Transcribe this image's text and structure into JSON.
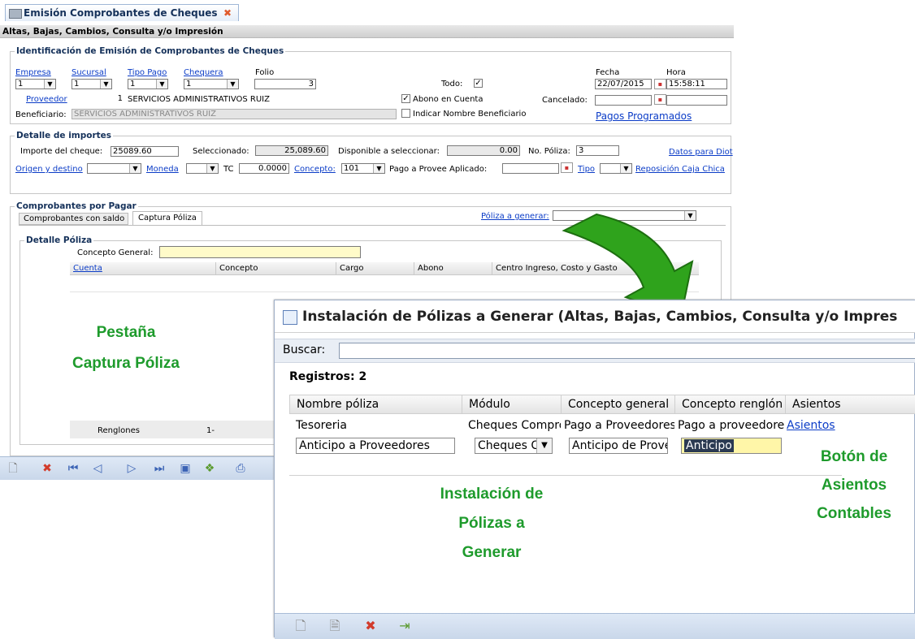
{
  "main": {
    "tab_title": "Emisión Comprobantes de Cheques",
    "subtitle": "Altas, Bajas, Cambios, Consulta y/o Impresión",
    "ident": {
      "legend": "Identificación de Emisión de Comprobantes de Cheques",
      "empresa_label": "Empresa",
      "empresa_value": "1",
      "sucursal_label": "Sucursal",
      "sucursal_value": "1",
      "tipo_pago_label": "Tipo Pago",
      "tipo_pago_value": "1",
      "chequera_label": "Chequera",
      "chequera_value": "1",
      "folio_label": "Folio",
      "folio_value": "3",
      "todo_label": "Todo:",
      "fecha_label": "Fecha",
      "fecha_value": "22/07/2015",
      "hora_label": "Hora",
      "hora_value": "15:58:11",
      "proveedor_label": "Proveedor",
      "proveedor_num": "1",
      "proveedor_name": "SERVICIOS ADMINISTRATIVOS RUIZ",
      "abono_label": "Abono en Cuenta",
      "cancelado_label": "Cancelado:",
      "beneficiario_label": "Beneficiario:",
      "beneficiario_value": "SERVICIOS ADMINISTRATIVOS RUIZ",
      "indicar_label": "Indicar Nombre Beneficiario",
      "pagos_link": "Pagos Programados"
    },
    "detalle": {
      "legend": "Detalle de importes",
      "importe_label": "Importe del cheque:",
      "importe_value": "25089.60",
      "seleccionado_label": "Seleccionado:",
      "seleccionado_value": "25,089.60",
      "disponible_label": "Disponible a seleccionar:",
      "disponible_value": "0.00",
      "poliza_label": "No. Póliza:",
      "poliza_value": "3",
      "diot_link": "Datos para Diot",
      "origen_link": "Origen y destino",
      "moneda_link": "Moneda",
      "tc_label": "TC",
      "tc_value": "0.0000",
      "concepto_link": "Concepto:",
      "concepto_value": "101",
      "concepto_text": "Pago a Provee",
      "aplicado_label": "Aplicado:",
      "tipo_link": "Tipo",
      "reposicion_link": "Reposición Caja Chica"
    },
    "comprobantes": {
      "legend": "Comprobantes por Pagar",
      "tab1": "Comprobantes con saldo",
      "tab2": "Captura Póliza",
      "poliza_generar_link": "Póliza a generar:",
      "detalle_legend": "Detalle Póliza",
      "concepto_general_label": "Concepto General:",
      "columns": [
        "Cuenta",
        "Concepto",
        "Cargo",
        "Abono",
        "Centro Ingreso, Costo y Gasto"
      ],
      "renglones_label": "Renglones",
      "renglones_value": "1-"
    }
  },
  "overlay": {
    "title": "Instalación de Pólizas a Generar (Altas, Bajas, Cambios, Consulta y/o Impres",
    "search_label": "Buscar:",
    "registros": "Registros: 2",
    "columns": [
      "Nombre póliza",
      "Módulo",
      "Concepto general",
      "Concepto renglón",
      "Asientos"
    ],
    "row1": {
      "nombre": "Tesoreria",
      "modulo": "Cheques Comprob",
      "concepto_general": "Pago a Proveedores",
      "concepto_renglon": "Pago a proveedores",
      "asientos": "Asientos"
    },
    "row2": {
      "nombre": "Anticipo a Proveedores",
      "modulo": "Cheques C",
      "concepto_general": "Anticipo de Prove",
      "concepto_renglon": "Anticipo"
    }
  },
  "annotations": {
    "pestana": [
      "Pestaña",
      "Captura Póliza"
    ],
    "instalacion": [
      "Instalación de",
      "Pólizas a",
      "Generar"
    ],
    "boton": [
      "Botón de",
      "Asientos",
      "Contables"
    ]
  },
  "colors": {
    "annotation": "#1e9b2c",
    "arrow": "#2fa31c",
    "link": "#0b3cc7",
    "legend": "#15315a"
  },
  "icons": [
    "document-icon",
    "delete-icon",
    "first-icon",
    "prev-icon",
    "next-icon",
    "last-icon",
    "save-icon",
    "export-icon",
    "print-icon",
    "exit-icon"
  ]
}
